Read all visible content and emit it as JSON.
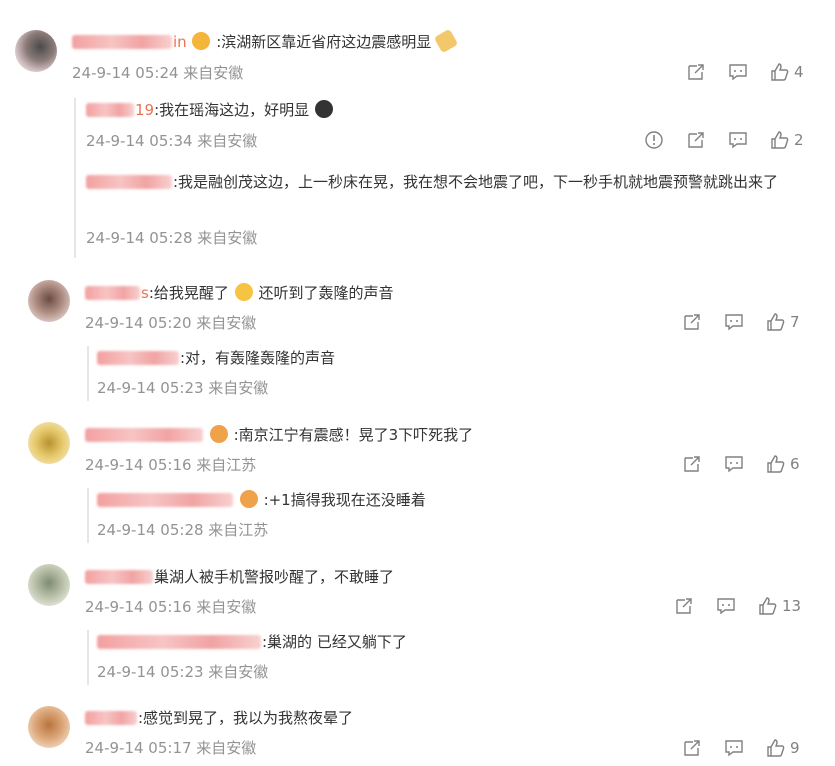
{
  "comments": [
    {
      "name_tail": "in",
      "text": ":滨湖新区靠近省府这边震感明显",
      "meta": "24-9-14 05:24 来自安徽",
      "likes": "4",
      "replies": [
        {
          "name_tail": "19",
          "text": ":我在瑶海这边，好明显",
          "meta": "24-9-14 05:34 来自安徽",
          "likes": "2"
        },
        {
          "name_tail": "",
          "text": ":我是融创茂这边，上一秒床在晃，我在想不会地震了吧，下一秒手机就地震预警就跳出来了",
          "meta": "24-9-14 05:28 来自安徽"
        }
      ]
    },
    {
      "name_tail": "s",
      "text": ":给我晃醒了",
      "text_after": "还听到了轰隆的声音",
      "meta": "24-9-14 05:20 来自安徽",
      "likes": "7",
      "replies": [
        {
          "name_tail": "",
          "text": ":对，有轰隆轰隆的声音",
          "meta": "24-9-14 05:23 来自安徽"
        }
      ]
    },
    {
      "name_tail": "",
      "text": ":南京江宁有震感！晃了3下吓死我了",
      "meta": "24-9-14 05:16 来自江苏",
      "likes": "6",
      "replies": [
        {
          "name_tail": "",
          "text": ":+1搞得我现在还没睡着",
          "meta": "24-9-14 05:28 来自江苏"
        }
      ]
    },
    {
      "name_tail": "",
      "text": "巢湖人被手机警报吵醒了，不敢睡了",
      "meta": "24-9-14 05:16 来自安徽",
      "likes": "13",
      "replies": [
        {
          "name_tail": "",
          "text": ":巢湖的 已经又躺下了",
          "meta": "24-9-14 05:23 来自安徽"
        }
      ]
    },
    {
      "name_tail": "",
      "text": ":感觉到晃了，我以为我熬夜晕了",
      "meta": "24-9-14 05:17 来自安徽",
      "likes": "9",
      "replies": []
    }
  ],
  "colors": {
    "username": "#eb7350",
    "meta": "#939393",
    "icon": "#808080"
  },
  "icons": [
    "share-icon",
    "comment-icon",
    "like-icon",
    "report-icon"
  ]
}
